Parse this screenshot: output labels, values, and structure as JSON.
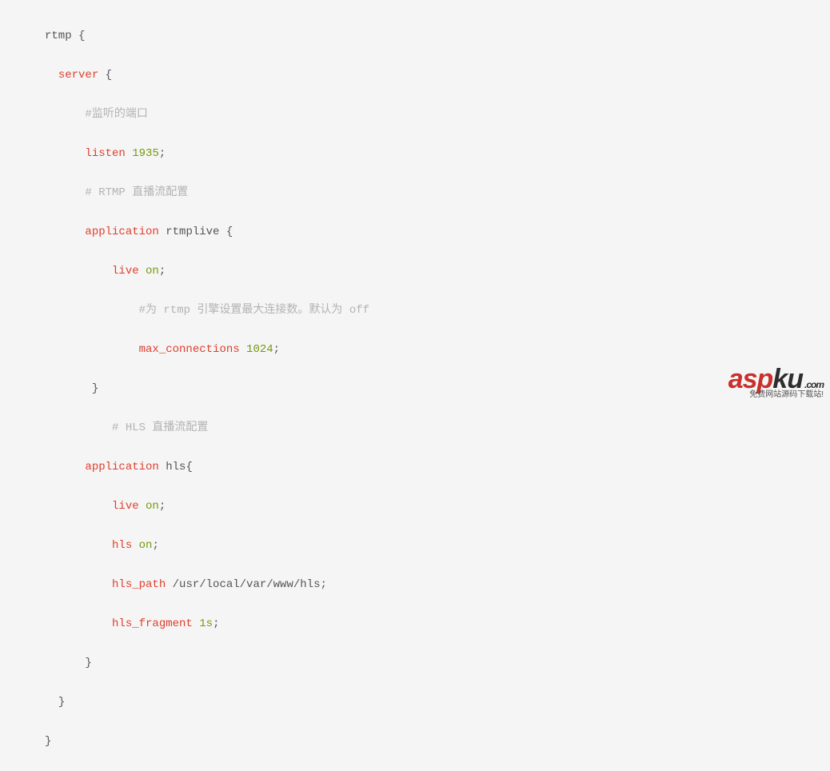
{
  "code": {
    "l1_rtmp": "rtmp",
    "l1_brace": " {",
    "l2_server": "server",
    "l2_brace": " {",
    "l3_comment": "#监听的端口",
    "l4_listen": "listen",
    "l4_port": " 1935",
    "l4_semi": ";",
    "l5_comment": "# RTMP 直播流配置",
    "l6_app": "application",
    "l6_name": " rtmplive {",
    "l7_live": "live",
    "l7_on": " on",
    "l7_semi": ";",
    "l8_comment": "#为 rtmp 引擎设置最大连接数。默认为 off",
    "l9_max": "max_connections",
    "l9_val": " 1024",
    "l9_semi": ";",
    "l10_brace": "}",
    "l11_comment": "# HLS 直播流配置",
    "l12_app": "application",
    "l12_name": " hls{",
    "l13_live": "live",
    "l13_on": " on",
    "l13_semi": ";",
    "l14_hls": "hls",
    "l14_on": " on",
    "l14_semi": ";",
    "l15_hlspath": "hls_path",
    "l15_path": " /usr/local/var/www/hls;",
    "l16_hlsfrag": "hls_fragment",
    "l16_val": " 1s",
    "l16_semi": ";",
    "l17_brace": "}",
    "l18_brace": "}",
    "l19_brace": "}"
  },
  "watermark": {
    "asp": "asp",
    "ku": "ku",
    "com": ".com",
    "sub": "免费网站源码下载站!"
  }
}
